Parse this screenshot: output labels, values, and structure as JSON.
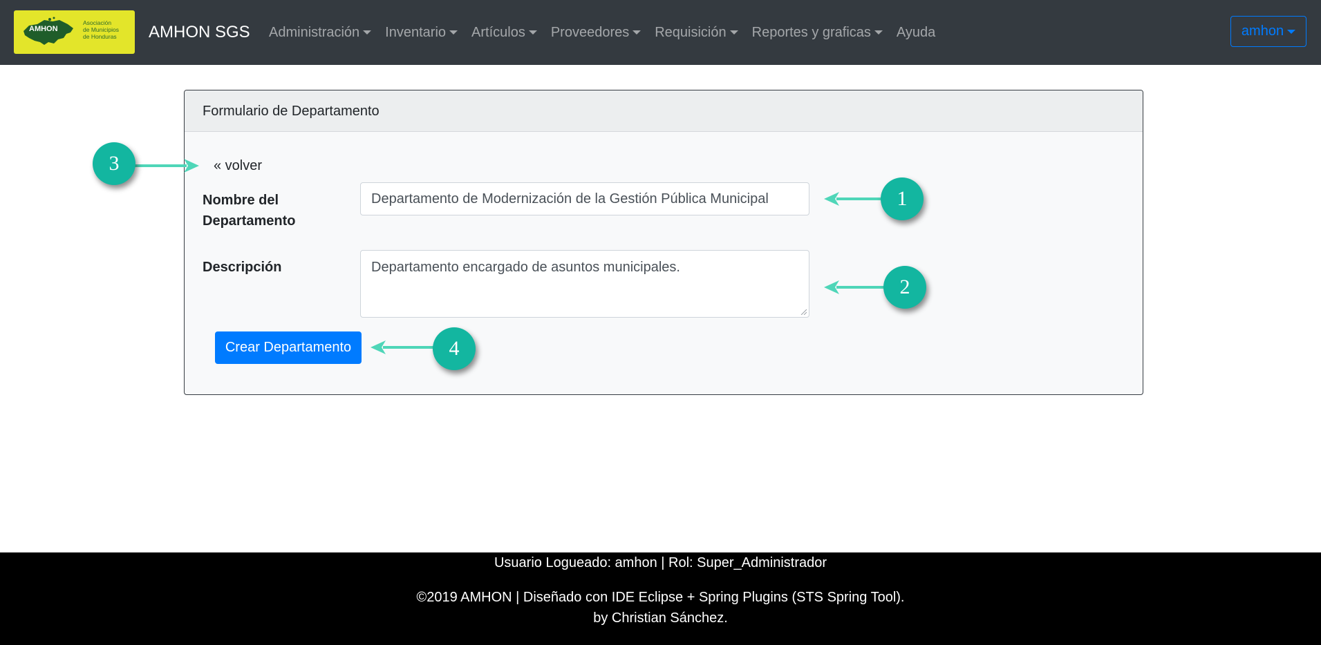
{
  "logo": {
    "acronym": "AMHON",
    "line1": "Asociación",
    "line2": "de Municipios",
    "line3": "de Honduras"
  },
  "navbar": {
    "brand": "AMHON SGS",
    "items": [
      {
        "label": "Administración",
        "dropdown": true
      },
      {
        "label": "Inventario",
        "dropdown": true
      },
      {
        "label": "Artículos",
        "dropdown": true
      },
      {
        "label": "Proveedores",
        "dropdown": true
      },
      {
        "label": "Requisición",
        "dropdown": true
      },
      {
        "label": "Reportes y graficas",
        "dropdown": true
      },
      {
        "label": "Ayuda",
        "dropdown": false
      }
    ],
    "user": "amhon"
  },
  "card": {
    "header": "Formulario de Departamento",
    "back_link": "« volver",
    "name_label": "Nombre del Departamento",
    "name_value": "Departamento de Modernización de la Gestión Pública Municipal",
    "desc_label": "Descripción",
    "desc_value": "Departamento encargado de asuntos municipales.",
    "submit_label": "Crear Departamento"
  },
  "annotations": {
    "m1": "1",
    "m2": "2",
    "m3": "3",
    "m4": "4"
  },
  "footer": {
    "line1": "Usuario Logueado: amhon | Rol: Super_Administrador",
    "line2": "©2019 AMHON | Diseñado con IDE Eclipse + Spring Plugins (STS Spring Tool).",
    "line3": "by Christian Sánchez."
  },
  "colors": {
    "navbar_bg": "#343a40",
    "logo_bg": "#e3e52a",
    "primary": "#007bff",
    "marker": "#13b6a0",
    "arrow": "#4fd6b8",
    "footer_bg": "#000000"
  }
}
